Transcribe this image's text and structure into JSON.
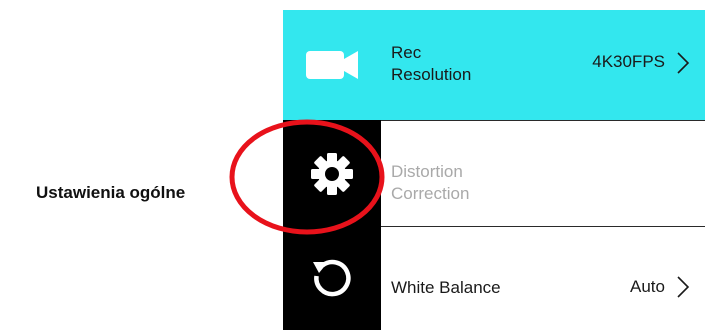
{
  "caption": "Ustawienia ogólne",
  "sidebar": {
    "items": [
      {
        "icon": "video-camera-icon",
        "selected": true
      },
      {
        "icon": "gear-icon",
        "selected": false
      },
      {
        "icon": "reset-icon",
        "selected": false
      }
    ]
  },
  "menu": {
    "rows": [
      {
        "label_line1": "Rec",
        "label_line2": "Resolution",
        "value": "4K30FPS",
        "highlighted": true
      },
      {
        "label_line1": "Distortion",
        "label_line2": "Correction",
        "disabled": true
      },
      {
        "label": "White Balance",
        "value": "Auto"
      }
    ]
  },
  "colors": {
    "accent": "#33e7ee",
    "sidebar": "#000000",
    "annotation": "#e8121b",
    "disabled_text": "#a9a9a9"
  }
}
